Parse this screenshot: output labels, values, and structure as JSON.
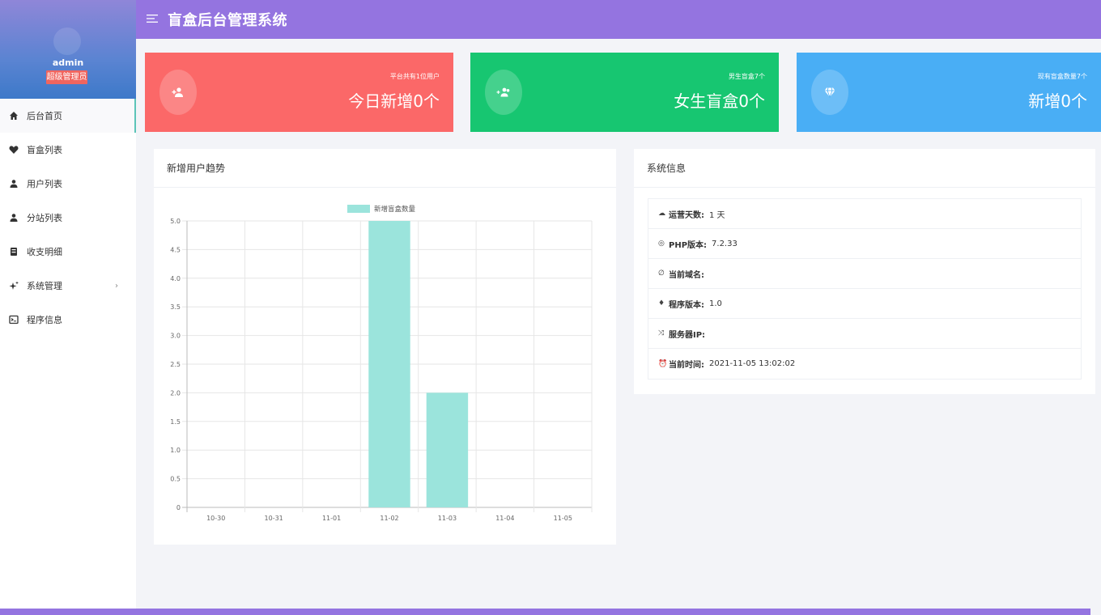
{
  "header": {
    "menu_icon": "menu-icon",
    "title": "盲盒后台管理系统"
  },
  "profile": {
    "username": "admin",
    "role": "超级管理员"
  },
  "sidebar": {
    "items": [
      {
        "label": "后台首页",
        "icon": "home-icon",
        "active": true
      },
      {
        "label": "盲盒列表",
        "icon": "heart-icon"
      },
      {
        "label": "用户列表",
        "icon": "user-icon"
      },
      {
        "label": "分站列表",
        "icon": "user-icon"
      },
      {
        "label": "收支明细",
        "icon": "ledger-icon"
      },
      {
        "label": "系统管理",
        "icon": "sparkle-icon",
        "expand": "›"
      },
      {
        "label": "程序信息",
        "icon": "terminal-icon"
      }
    ]
  },
  "cards": [
    {
      "small": "平台共有1位用户",
      "big": "今日新增0个",
      "color": "#fb6868",
      "icon": "user-add-icon"
    },
    {
      "small": "男生盲盒7个",
      "big": "女生盲盒0个",
      "color": "#17c671",
      "icon": "users-icon"
    },
    {
      "small": "现有盲盒数量7个",
      "big": "新增0个",
      "color": "#49aef5",
      "icon": "diamond-icon"
    }
  ],
  "trend_panel": {
    "title": "新增用户趋势"
  },
  "chart_data": {
    "type": "bar",
    "categories": [
      "10-30",
      "10-31",
      "11-01",
      "11-02",
      "11-03",
      "11-04",
      "11-05"
    ],
    "series": [
      {
        "name": "新增盲盒数量",
        "values": [
          0,
          0,
          0,
          5,
          2,
          0,
          0
        ]
      }
    ],
    "ylim": [
      0,
      5
    ],
    "yticks": [
      "0",
      "0.5",
      "1.0",
      "1.5",
      "2.0",
      "2.5",
      "3.0",
      "3.5",
      "4.0",
      "4.5",
      "5.0"
    ],
    "legend": "top",
    "grid": true,
    "bar_color": "#9be4dc"
  },
  "sysinfo": {
    "title": "系统信息",
    "rows": [
      {
        "icon": "cloud-icon",
        "key": "运营天数:",
        "value": "1 天"
      },
      {
        "icon": "eye-icon",
        "key": "PHP版本:",
        "value": "7.2.33"
      },
      {
        "icon": "link-icon",
        "key": "当前域名:",
        "value": ""
      },
      {
        "icon": "android-icon",
        "key": "程序版本:",
        "value": "1.0"
      },
      {
        "icon": "shuffle-icon",
        "key": "服务器IP:",
        "value": ""
      },
      {
        "icon": "alarm-icon",
        "key": "当前时间:",
        "value": "2021-11-05 13:02:02"
      }
    ]
  }
}
